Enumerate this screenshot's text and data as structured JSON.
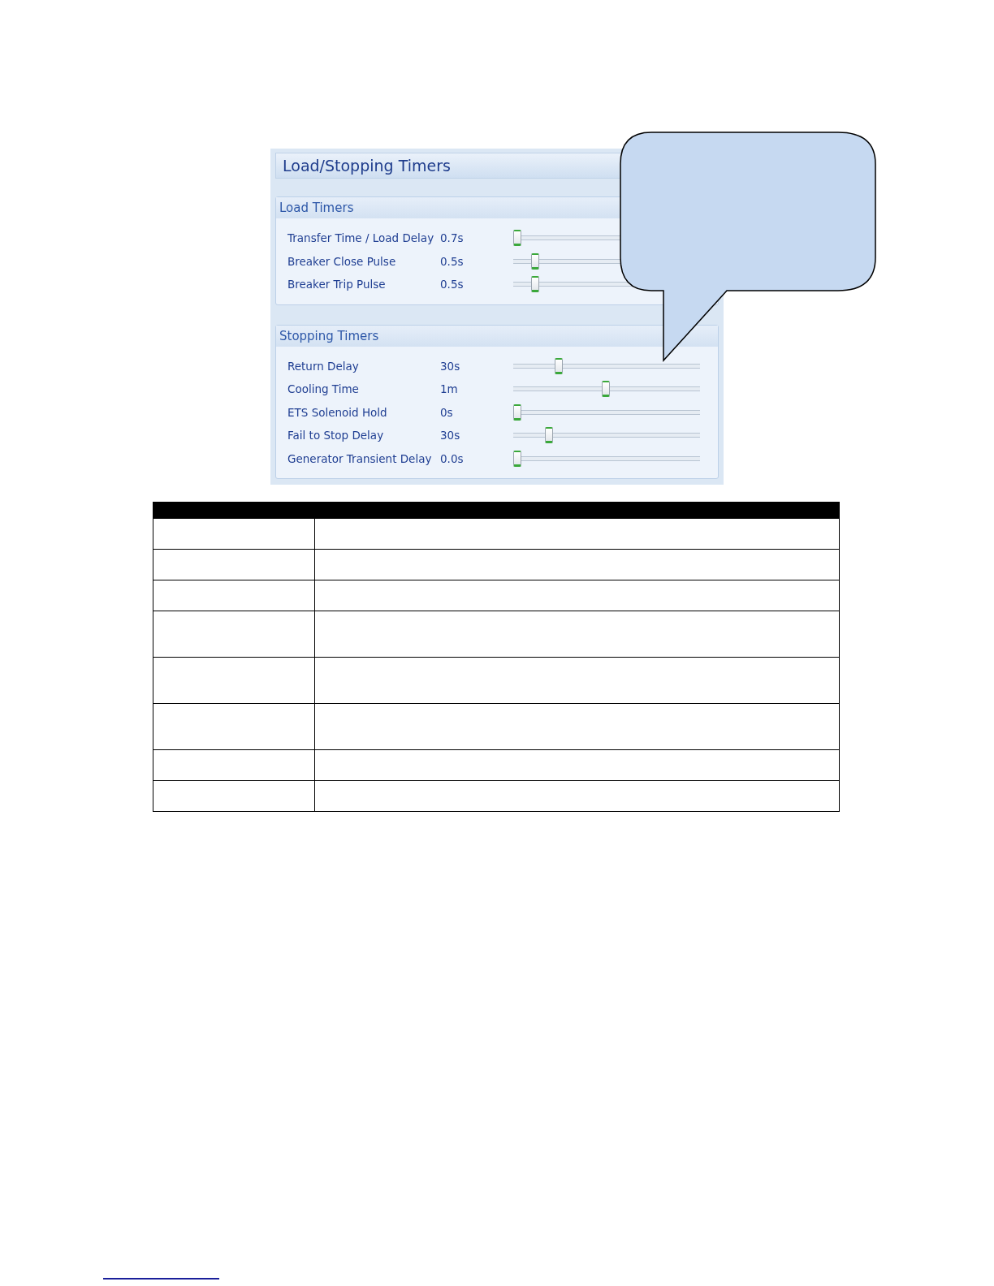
{
  "panel": {
    "title": "Load/Stopping Timers",
    "groups": [
      {
        "title": "Load Timers",
        "rows": [
          {
            "label": "Transfer Time / Load Delay",
            "value": "0.7s",
            "level": 0
          },
          {
            "label": "Breaker Close Pulse",
            "value": "0.5s",
            "level": 0.1
          },
          {
            "label": "Breaker Trip Pulse",
            "value": "0.5s",
            "level": 0.1
          }
        ]
      },
      {
        "title": "Stopping Timers",
        "rows": [
          {
            "label": "Return Delay",
            "value": "30s",
            "level": 0.235
          },
          {
            "label": "Cooling Time",
            "value": "1m",
            "level": 0.5
          },
          {
            "label": "ETS Solenoid Hold",
            "value": "0s",
            "level": 0
          },
          {
            "label": "Fail to Stop Delay",
            "value": "30s",
            "level": 0.18
          },
          {
            "label": "Generator Transient Delay",
            "value": "0.0s",
            "level": 0
          }
        ]
      }
    ]
  },
  "table": {
    "rows": [
      {
        "kind": "single"
      },
      {
        "kind": "single"
      },
      {
        "kind": "single"
      },
      {
        "kind": "double"
      },
      {
        "kind": "double"
      },
      {
        "kind": "double"
      },
      {
        "kind": "single"
      },
      {
        "kind": "single"
      }
    ]
  }
}
